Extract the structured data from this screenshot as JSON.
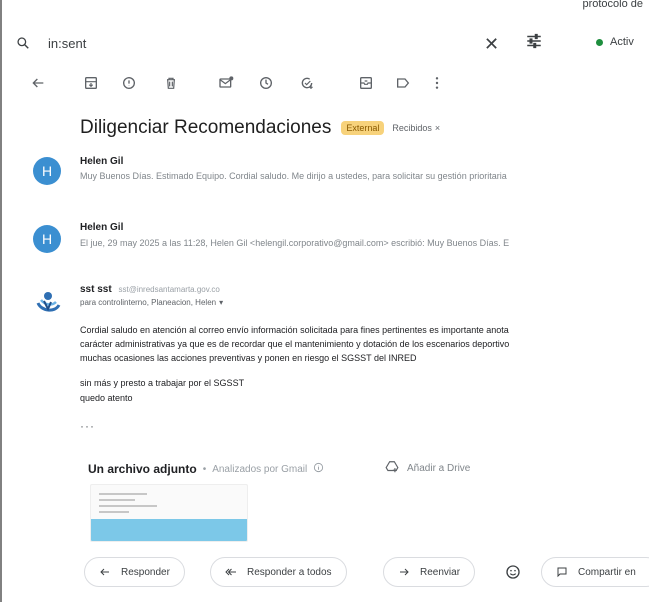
{
  "top_right_text": "protocolo de",
  "search": {
    "query": "in:sent",
    "status_label": "Activ"
  },
  "subject": {
    "title": "Diligenciar Recomendaciones",
    "badge_external": "External",
    "label_chip": "Recibidos"
  },
  "messages": [
    {
      "avatar_letter": "H",
      "sender": "Helen Gil",
      "snippet": "Muy Buenos Días. Estimado Equipo. Cordial saludo. Me dirijo a ustedes, para solicitar su gestión prioritaria"
    },
    {
      "avatar_letter": "H",
      "sender": "Helen Gil",
      "snippet": "El jue, 29 may 2025 a las 11:28, Helen Gil <helengil.corporativo@gmail.com> escribió: Muy Buenos Días. E"
    }
  ],
  "open_message": {
    "sender_name": "sst sst",
    "sender_email": "sst@inredsantamarta.gov.co",
    "to_line": "para controlinterno, Planeacion, Helen",
    "body": [
      "Cordial saludo en atención al correo envío información solicitada para fines pertinentes es importante anota",
      "carácter administrativas ya que es de recordar que el mantenimiento y dotación de los escenarios deportivo",
      "muchas ocasiones las acciones preventivas y ponen en riesgo el SGSST del INRED",
      "sin más y presto a trabajar por el SGSST",
      "quedo atento"
    ],
    "ellipsis": "···"
  },
  "attachment": {
    "title": "Un archivo adjunto",
    "separator": "•",
    "scan_status": "Analizados por Gmail",
    "add_drive": "Añadir a Drive"
  },
  "actions": {
    "reply": "Responder",
    "reply_all": "Responder a todos",
    "forward": "Reenviar",
    "share": "Compartir en"
  },
  "colors": {
    "avatar": "#3b8fd1",
    "badge_external": "#f7d27b",
    "status_dot": "#1e8e3e",
    "thumb_band": "#7cc8e8"
  }
}
